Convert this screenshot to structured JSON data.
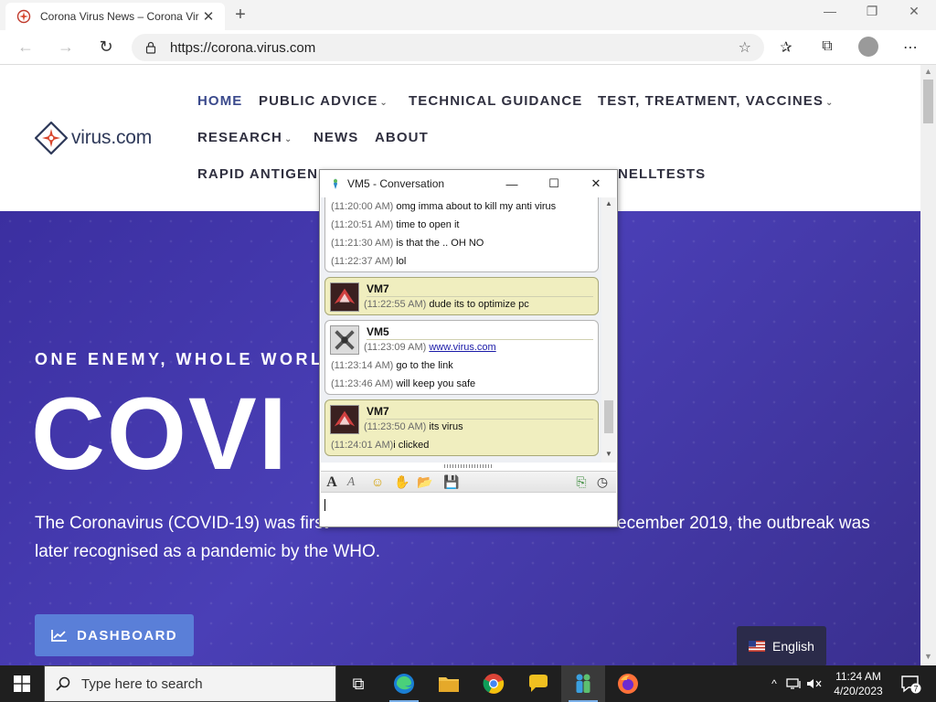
{
  "browser": {
    "tab_title": "Corona Virus News – Corona Vir",
    "new_tab_glyph": "+",
    "url": "https://corona.virus.com",
    "minimize_glyph": "—",
    "maximize_glyph": "❐",
    "close_glyph": "✕",
    "tab_close_glyph": "✕",
    "back_glyph": "←",
    "forward_glyph": "→",
    "refresh_glyph": "↻",
    "star_glyph": "☆",
    "favorites_glyph": "✰",
    "collections_glyph": "⧉",
    "menu_glyph": "⋯"
  },
  "site": {
    "logo_text": "virus.com",
    "nav": {
      "home": "HOME",
      "public_advice": "PUBLIC ADVICE",
      "technical_guidance": "TECHNICAL GUIDANCE",
      "test_treatment": "TEST, TREATMENT, VACCINES",
      "research": "RESEARCH",
      "news": "NEWS",
      "about": "ABOUT",
      "rapid_antigen": "RAPID ANTIGEN",
      "rapid_antigen_tail": "NELLTESTS"
    },
    "hero": {
      "tagline": "ONE ENEMY, WHOLE WORLD",
      "title": "COVI",
      "desc_left": "The Coronavirus (COVID-19) was first",
      "desc_right": "ecember 2019, the outbreak was",
      "desc_line2": "later recognised as a pandemic by the WHO.",
      "dashboard_label": "DASHBOARD",
      "language_label": "English"
    },
    "colors": {
      "hero": "#3b2fa0",
      "nav_active": "#3b4a8c",
      "dashboard": "#5a7fd8",
      "accent": "#d8452b"
    }
  },
  "chat": {
    "title": "VM5 - Conversation",
    "min_glyph": "—",
    "max_glyph": "☐",
    "close_glyph": "✕",
    "block1": [
      {
        "ts": "(11:20:00 AM)",
        "text": "omg imma about to kill my anti virus"
      },
      {
        "ts": "(11:20:51 AM)",
        "text": "time to open it"
      },
      {
        "ts": "(11:21:30 AM)",
        "text": "is that the .. OH NO"
      },
      {
        "ts": "(11:22:37 AM)",
        "text": "lol"
      }
    ],
    "block2": {
      "sender": "VM7",
      "lines": [
        {
          "ts": "(11:22:55 AM)",
          "text": "dude its to optimize pc"
        }
      ]
    },
    "block3": {
      "sender": "VM5",
      "lines": [
        {
          "ts": "(11:23:09 AM)",
          "text": "www.virus.com"
        },
        {
          "ts": "(11:23:14 AM)",
          "text": "go to the link"
        },
        {
          "ts": "(11:23:46 AM)",
          "text": "will keep you safe"
        }
      ]
    },
    "block4": {
      "sender": "VM7",
      "lines": [
        {
          "ts": "(11:23:50 AM)",
          "text": "its virus"
        },
        {
          "ts": "(11:24:01 AM)",
          "text": "i clicked"
        }
      ]
    },
    "toolbar": {
      "font_glyph": "A",
      "font_color_glyph": "A",
      "emoticon_glyph": "☺",
      "nudge_glyph": "✋",
      "files_glyph": "📂",
      "save_glyph": "💾",
      "send_file_glyph": "⎘",
      "history_glyph": "◷"
    },
    "input_value": ""
  },
  "taskbar": {
    "search_placeholder": "Type here to search",
    "time": "11:24 AM",
    "date": "4/20/2023",
    "notif_count": "7",
    "up_glyph": "^",
    "task_view_glyph": "⧉"
  }
}
